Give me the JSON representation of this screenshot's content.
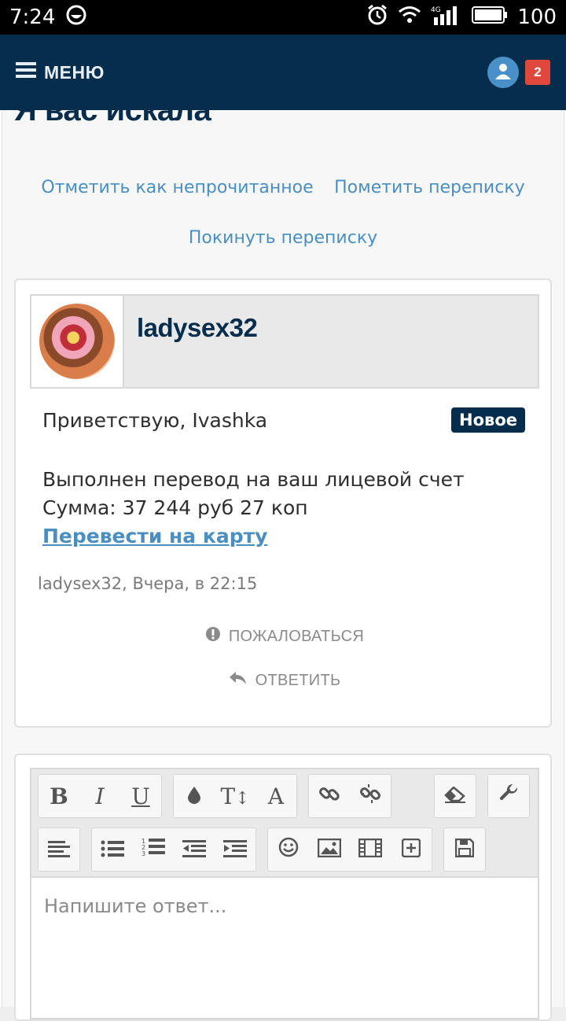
{
  "status_bar": {
    "time": "7:24",
    "battery": "100",
    "network": "4G"
  },
  "navbar": {
    "menu_label": "МЕНЮ",
    "notification_count": "2"
  },
  "page": {
    "title": "Я вас искала",
    "actions": {
      "mark_unread": "Отметить как непрочитанное",
      "mark_conversation": "Пометить переписку",
      "leave_conversation": "Покинуть переписку"
    }
  },
  "message": {
    "author": "ladysex32",
    "greeting": "Приветствую, Ivashka",
    "badge": "Новое",
    "line1": "Выполнен перевод на ваш лицевой счет",
    "line2": "Сумма: 37 244 руб 27 коп",
    "link": "Перевести на карту",
    "meta": "ladysex32, Вчера, в 22:15",
    "report": "ПОЖАЛОВАТЬСЯ",
    "reply": "ОТВЕТИТЬ"
  },
  "editor": {
    "placeholder": "Напишите ответ..."
  },
  "colors": {
    "navbar": "#072d4d",
    "link": "#4a8fc0",
    "badge_count": "#e0483e"
  }
}
